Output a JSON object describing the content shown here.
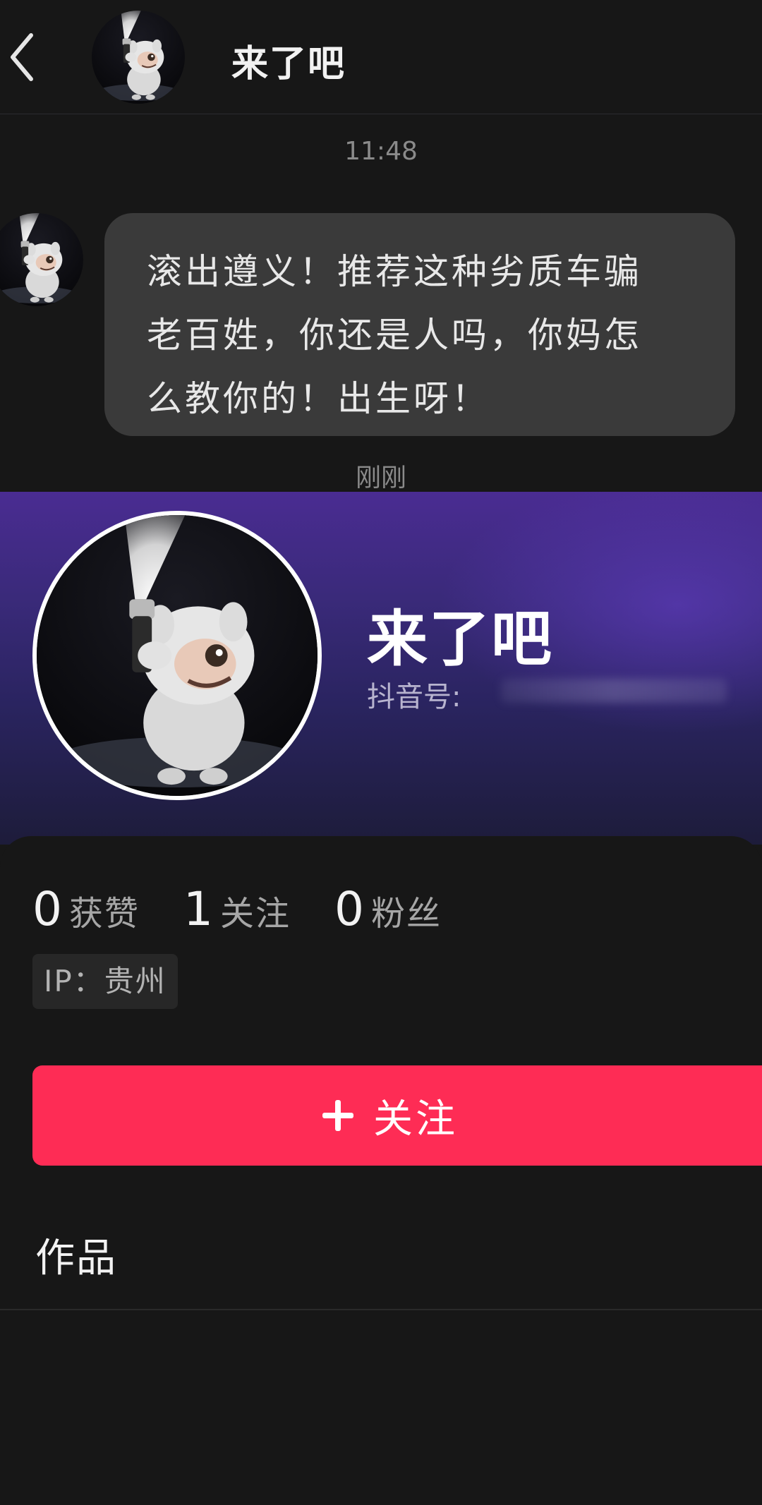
{
  "header": {
    "title": "来了吧",
    "back_icon": "chevron-left-icon",
    "avatar_desc_icon": "avatar-icon"
  },
  "chat": {
    "timestamp": "11:48",
    "message_lines": [
      "滚出遵义！推荐这种劣质车骗",
      "老百姓，你还是人吗，你妈怎",
      "么教你的！出生呀！"
    ],
    "status": "刚刚"
  },
  "profile": {
    "name": "来了吧",
    "douyin_id_label": "抖音号:",
    "stats": [
      {
        "num": "0",
        "label": "获赞"
      },
      {
        "num": "1",
        "label": "关注"
      },
      {
        "num": "0",
        "label": "粉丝"
      }
    ],
    "ip_label": "IP：贵州",
    "follow_button": "关注",
    "works_tab": "作品"
  },
  "colors": {
    "accent": "#fe2c55",
    "background": "#171717",
    "bubble": "#3a3a3a"
  }
}
